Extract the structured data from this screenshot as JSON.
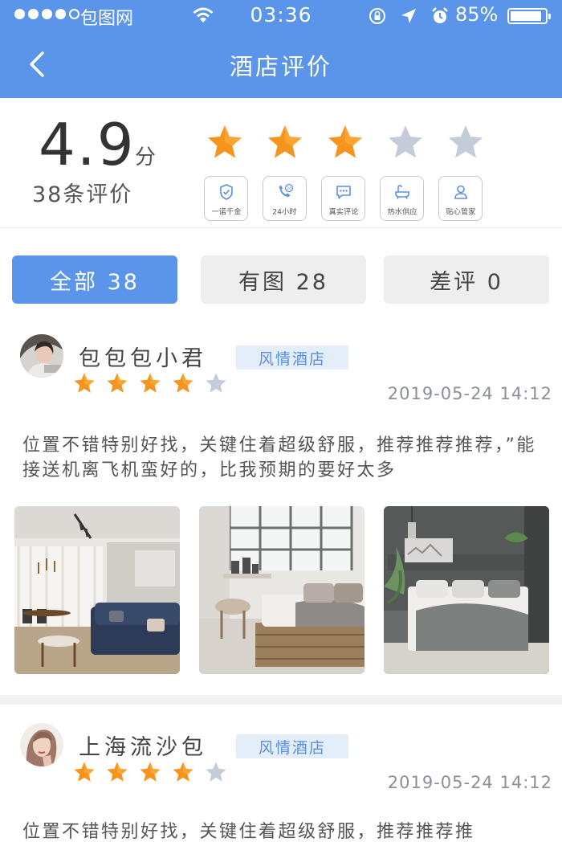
{
  "status_bar": {
    "carrier": "包图网",
    "time": "03:36",
    "battery": "85%"
  },
  "nav": {
    "title": "酒店评价",
    "back_icon": "chevron-left-icon"
  },
  "summary": {
    "score": "4.9",
    "score_unit": "分",
    "review_count": "38条评价",
    "rating": 3,
    "rating_max": 5,
    "features": [
      {
        "label": "一诺千金",
        "icon": "shield-check-icon"
      },
      {
        "label": "24小时",
        "icon": "phone-24-icon"
      },
      {
        "label": "真实评论",
        "icon": "chat-bubble-icon"
      },
      {
        "label": "热水供应",
        "icon": "bathtub-icon"
      },
      {
        "label": "贴心管家",
        "icon": "butler-icon"
      }
    ]
  },
  "tabs": [
    {
      "label": "全部 38",
      "active": true
    },
    {
      "label": "有图 28",
      "active": false
    },
    {
      "label": "差评 0",
      "active": false
    }
  ],
  "reviews": [
    {
      "user": "包包包小君",
      "tag": "风情酒店",
      "rating": 4,
      "date": "2019-05-24 14:12",
      "content": "位置不错特别好找，关键住着超级舒服，推荐推荐推荐，”能接送机离飞机蛮好的，比我预期的要好太多",
      "photos": [
        "living-room-photo",
        "bedroom-pallet-photo",
        "bedroom-gray-photo"
      ]
    },
    {
      "user": "上海流沙包",
      "tag": "风情酒店",
      "rating": 4,
      "date": "2019-05-24 14:12",
      "content": "位置不错特别好找，关键住着超级舒服，推荐推荐推"
    }
  ],
  "colors": {
    "primary": "#5a95ea",
    "star_on": "#f7941d",
    "star_off": "#c3ccd8",
    "tag_bg": "#e4eefb",
    "tag_text": "#5a8fe0"
  }
}
